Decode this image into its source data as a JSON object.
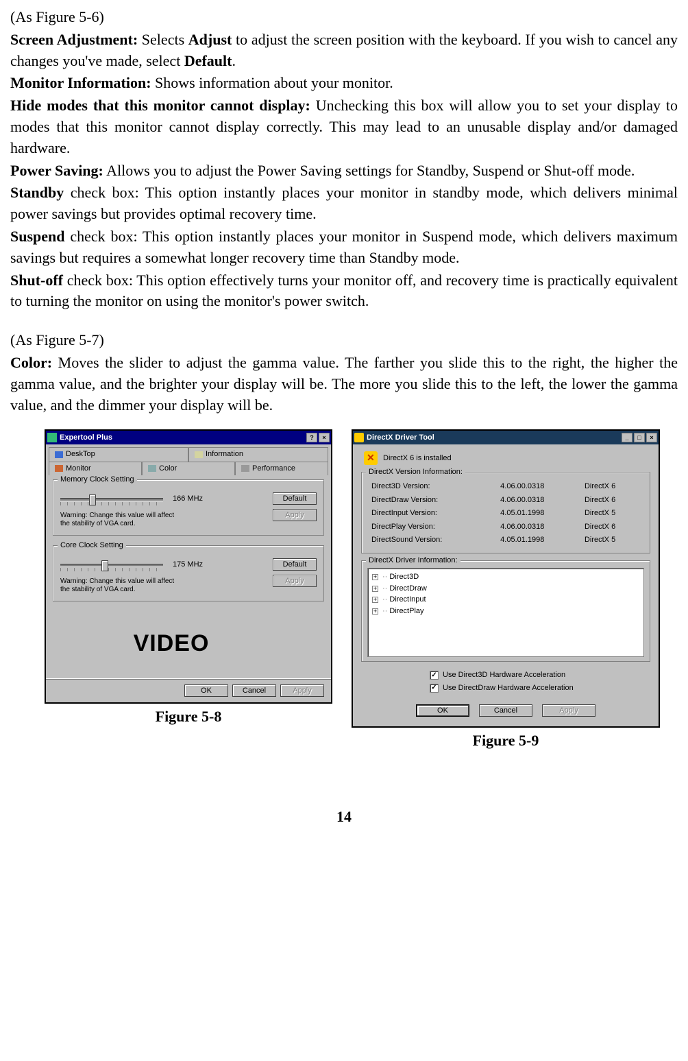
{
  "body": {
    "fig56_ref": "(As Figure 5-6)",
    "p1_a": "Screen Adjustment:",
    "p1_b": " Selects ",
    "p1_c": "Adjust",
    "p1_d": " to adjust the screen position with the keyboard. If you wish to cancel any changes you've made, select ",
    "p1_e": "Default",
    "p1_f": ".",
    "p2_a": "Monitor Information:",
    "p2_b": " Shows information about your monitor.",
    "p3_a": "Hide modes that this monitor cannot display:",
    "p3_b": " Unchecking this box will allow you to set your display to modes that this monitor cannot display correctly.   This may lead to an unusable display and/or damaged hardware.",
    "p4_a": "Power Saving:",
    "p4_b": " Allows you to adjust the Power Saving settings for Standby, Suspend or Shut-off mode.",
    "p5_a": "Standby",
    "p5_b": " check box: This option instantly places your monitor in standby mode, which delivers minimal power savings but provides optimal recovery time.",
    "p6_a": "Suspend",
    "p6_b": " check box: This option instantly places your monitor in Suspend mode, which delivers maximum savings but requires a somewhat longer recovery time than Standby mode.",
    "p7_a": "Shut-off",
    "p7_b": " check box: This option effectively turns your monitor off, and recovery time is practically equivalent to turning the monitor on using the monitor's power switch.",
    "fig57_ref": "(As Figure 5-7)",
    "p8_a": "Color:",
    "p8_b": " Moves the slider to adjust the gamma value.   The farther you slide this to the right, the higher the gamma value, and the brighter your display will be.   The more you slide this to the left, the lower the gamma value, and the dimmer your display will be."
  },
  "fig58": {
    "caption": "Figure 5-8",
    "title": "Expertool Plus",
    "tabs": {
      "desktop": "DeskTop",
      "information": "Information",
      "monitor": "Monitor",
      "color": "Color",
      "performance": "Performance"
    },
    "memGroup": "Memory Clock Setting",
    "memVal": "166 MHz",
    "coreGroup": "Core Clock Setting",
    "coreVal": "175 MHz",
    "warn": "Warning: Change this value will affect the stability of VGA card.",
    "defaultBtn": "Default",
    "applyBtn": "Apply",
    "brand": "VIDEO",
    "ok": "OK",
    "cancel": "Cancel",
    "apply": "Apply"
  },
  "fig59": {
    "caption": "Figure 5-9",
    "title": "DirectX Driver Tool",
    "installed": "DirectX 6 is installed",
    "verGroup": "DirectX Version Information:",
    "verRows": [
      {
        "label": "Direct3D Version:",
        "ver": "4.06.00.0318",
        "name": "DirectX 6"
      },
      {
        "label": "DirectDraw Version:",
        "ver": "4.06.00.0318",
        "name": "DirectX 6"
      },
      {
        "label": "DirectInput Version:",
        "ver": "4.05.01.1998",
        "name": "DirectX 5"
      },
      {
        "label": "DirectPlay Version:",
        "ver": "4.06.00.0318",
        "name": "DirectX 6"
      },
      {
        "label": "DirectSound Version:",
        "ver": "4.05.01.1998",
        "name": "DirectX 5"
      }
    ],
    "drvGroup": "DirectX Driver Information:",
    "tree": [
      "Direct3D",
      "DirectDraw",
      "DirectInput",
      "DirectPlay"
    ],
    "chk1": "Use Direct3D Hardware Acceleration",
    "chk2": "Use DirectDraw Hardware Acceleration",
    "ok": "OK",
    "cancel": "Cancel",
    "apply": "Apply"
  },
  "pageNumber": "14"
}
